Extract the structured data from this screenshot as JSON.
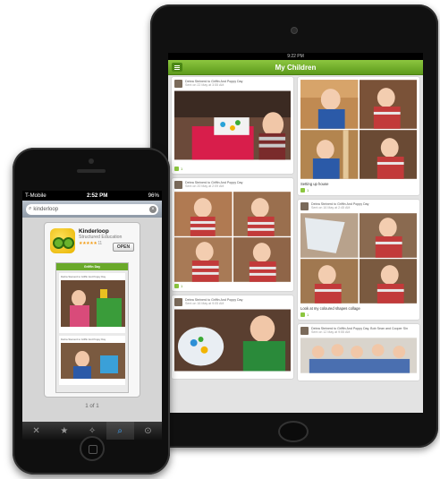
{
  "ipad": {
    "status_time": "9:22 PM",
    "nav_title": "My Children",
    "feed_left": [
      {
        "meta": "Debra Steinerd to Griffin And Poppy Day",
        "sub": "Sent on 22 May at 3:55 AM",
        "likes": "1"
      },
      {
        "meta": "Debra Steinerd to Griffin And Poppy Day",
        "sub": "Sent on 20 May at 2:09 AM",
        "likes": "1"
      },
      {
        "meta": "Debra Steinerd to Griffin And Poppy Day",
        "sub": "Sent on 16 May at 9:05 AM"
      }
    ],
    "feed_right": [
      {
        "caption": "Setting up house",
        "likes": "1"
      },
      {
        "meta": "Debra Steinerd to Griffin And Poppy Day",
        "sub": "Sent on 16 May at 2:45 AM",
        "caption": "Look at my coloured shapes collage",
        "likes": "1"
      },
      {
        "meta": "Debra Steinerd to Griffin And Poppy Day, Bob Sean and Cooper Sin",
        "sub": "Sent on 12 May at 9:55 AM"
      }
    ]
  },
  "iphone": {
    "carrier": "T-Mobile",
    "time": "2:52 PM",
    "battery": "96%",
    "search_query": "kinderloop",
    "app": {
      "name": "Kinderloop",
      "developer": "Structured Education",
      "stars": "★★★★★",
      "rating_count": "11",
      "open_label": "OPEN"
    },
    "shot": {
      "nav_title": "Griffin Day",
      "meta_1": "Debra Steinerd to Griffin And Poppy Day",
      "meta_2": "Debra Steinerd to Griffin And Poppy Day"
    },
    "page_indicator": "1 of 1",
    "tabs": [
      {
        "name": "featured",
        "icon": "ribbon-icon"
      },
      {
        "name": "top-charts",
        "icon": "star-icon"
      },
      {
        "name": "explore",
        "icon": "compass-icon"
      },
      {
        "name": "search",
        "icon": "search-icon"
      },
      {
        "name": "updates",
        "icon": "download-icon"
      }
    ]
  },
  "colors": {
    "brand_green": "#6aa92a",
    "ios_blue": "#3fa7ff"
  }
}
